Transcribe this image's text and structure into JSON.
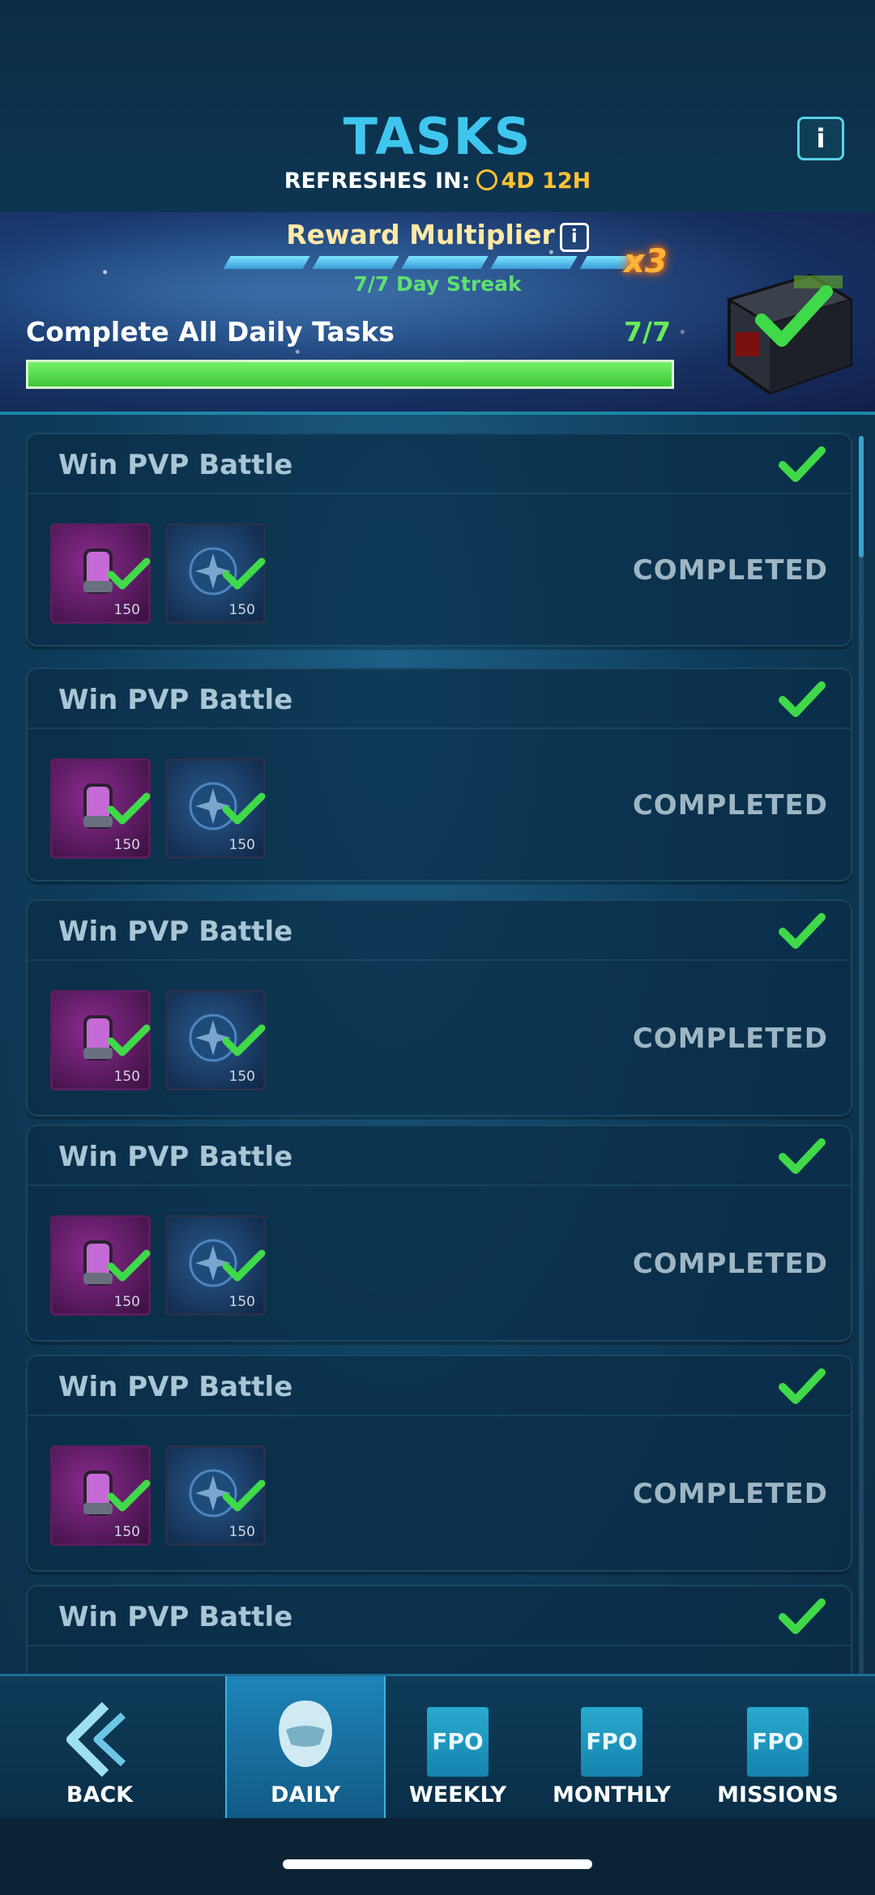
{
  "header": {
    "title": "TASKS",
    "refresh_label": "REFRESHES IN:",
    "refresh_time": "4D 12H",
    "info_label": "i"
  },
  "banner": {
    "multiplier_label": "Reward Multiplier",
    "multiplier_value": "x3",
    "streak_text": "7/7 Day Streak",
    "streak_segments_filled": 5,
    "category_label": "Complete All Daily Tasks",
    "category_count": "7/7",
    "progress_fraction": 1.0
  },
  "tasks": [
    {
      "title": "Win PVP Battle",
      "rewards": [
        "150",
        "150"
      ],
      "status": "COMPLETED"
    },
    {
      "title": "Win PVP Battle",
      "rewards": [
        "150",
        "150"
      ],
      "status": "COMPLETED"
    },
    {
      "title": "Win PVP Battle",
      "rewards": [
        "150",
        "150"
      ],
      "status": "COMPLETED"
    },
    {
      "title": "Win PVP Battle",
      "rewards": [
        "150",
        "150"
      ],
      "status": "COMPLETED"
    },
    {
      "title": "Win PVP Battle",
      "rewards": [
        "150",
        "150"
      ],
      "status": "COMPLETED"
    },
    {
      "title": "Win PVP Battle",
      "rewards": [],
      "status": ""
    }
  ],
  "nav": {
    "back": "BACK",
    "daily": "DAILY",
    "weekly": "WEEKLY",
    "monthly": "MONTHLY",
    "missions": "MISSIONS",
    "placeholder_icon_text": "FPO"
  },
  "colors": {
    "accent": "#3fc6ee",
    "check_green": "#3fd94a",
    "timer_yellow": "#ffc233"
  }
}
